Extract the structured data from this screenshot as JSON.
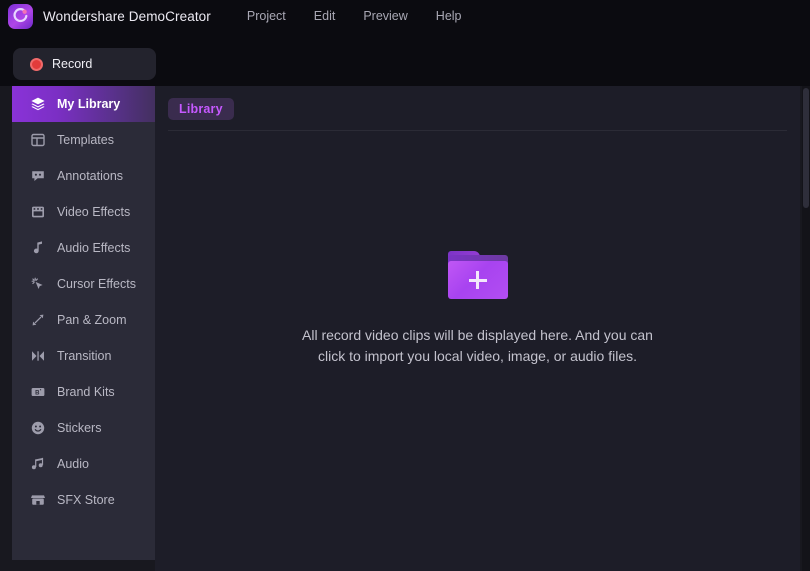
{
  "app": {
    "title": "Wondershare DemoCreator",
    "logo_icon": "democreator-logo-icon"
  },
  "menu": {
    "items": [
      {
        "label": "Project"
      },
      {
        "label": "Edit"
      },
      {
        "label": "Preview"
      },
      {
        "label": "Help"
      }
    ]
  },
  "toolbar": {
    "record_label": "Record",
    "record_icon": "record-dot-icon"
  },
  "sidebar": {
    "items": [
      {
        "label": "My Library",
        "icon": "layers-icon",
        "active": true
      },
      {
        "label": "Templates",
        "icon": "layout-grid-icon",
        "active": false
      },
      {
        "label": "Annotations",
        "icon": "speech-bubble-icon",
        "active": false
      },
      {
        "label": "Video Effects",
        "icon": "film-strip-icon",
        "active": false
      },
      {
        "label": "Audio Effects",
        "icon": "music-note-icon",
        "active": false
      },
      {
        "label": "Cursor Effects",
        "icon": "cursor-sparkle-icon",
        "active": false
      },
      {
        "label": "Pan & Zoom",
        "icon": "diagonal-arrows-icon",
        "active": false
      },
      {
        "label": "Transition",
        "icon": "transition-icon",
        "active": false
      },
      {
        "label": "Brand Kits",
        "icon": "brand-card-icon",
        "active": false
      },
      {
        "label": "Stickers",
        "icon": "smiley-icon",
        "active": false
      },
      {
        "label": "Audio",
        "icon": "music-notes-icon",
        "active": false
      },
      {
        "label": "SFX Store",
        "icon": "store-icon",
        "active": false
      }
    ]
  },
  "main": {
    "tabs": [
      {
        "label": "Library",
        "active": true
      }
    ],
    "empty_state": {
      "icon": "folder-plus-icon",
      "message": "All record video clips will be displayed here. And you can click to import you local video, image, or audio files."
    }
  },
  "colors": {
    "accent_purple": "#c659ff",
    "active_nav_gradient_start": "#8a33d8",
    "record_red": "#e23b3b",
    "sidebar_bg": "#2b2b38",
    "panel_bg": "#1d1d28",
    "titlebar_bg": "#0b0b10"
  }
}
